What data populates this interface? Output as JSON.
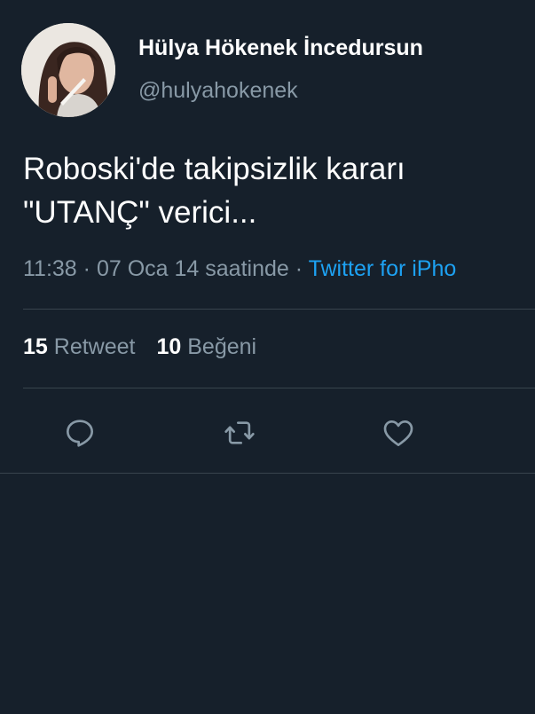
{
  "user": {
    "display_name": "Hülya Hökenek İncedursun",
    "handle": "@hulyahokenek"
  },
  "tweet": {
    "text_lines": [
      "Roboski'de takipsizlik kararı",
      "\"UTANÇ\" verici..."
    ],
    "time": "11:38",
    "sep1": "·",
    "date": "07 Oca 14 saatinde",
    "sep2": "·",
    "source": "Twitter for iPho"
  },
  "stats": {
    "retweets_count": "15",
    "retweets_label": "Retweet",
    "likes_count": "10",
    "likes_label": "Beğeni"
  },
  "icons": {
    "reply": "reply-icon",
    "retweet": "retweet-icon",
    "like": "heart-icon"
  },
  "colors": {
    "background": "#16202b",
    "text": "#ffffff",
    "secondary": "#8899a6",
    "link": "#1da1f2",
    "divider": "#38444d"
  }
}
